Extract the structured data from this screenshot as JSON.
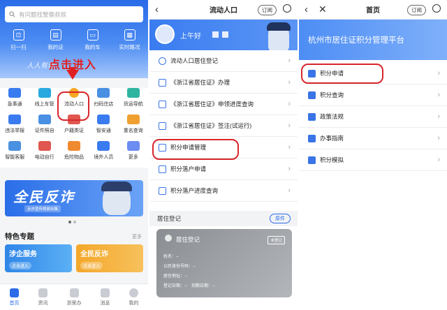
{
  "panel1": {
    "search_placeholder": "有问题找警察叔叔",
    "top_icons": [
      {
        "label": "扫一扫",
        "icon": "scan-icon"
      },
      {
        "label": "我的证",
        "icon": "card-icon"
      },
      {
        "label": "我的车",
        "icon": "car-icon"
      },
      {
        "label": "实时路况",
        "icon": "traffic-icon"
      }
    ],
    "banner_slogan": "人人有责",
    "click_hint": "点击进入",
    "grid": [
      [
        {
          "label": "急事通",
          "color": "#3a7cf0"
        },
        {
          "label": "线上车管",
          "color": "#29a8e0"
        },
        {
          "label": "流动人口",
          "color": "#f5a623"
        },
        {
          "label": "扫码住店",
          "color": "#4a90e2"
        },
        {
          "label": "货运导航",
          "color": "#2fb4a0"
        }
      ],
      [
        {
          "label": "违法举报",
          "color": "#3a7cf0"
        },
        {
          "label": "证件照自",
          "color": "#4a90e2"
        },
        {
          "label": "户籍类证",
          "color": "#e0574f"
        },
        {
          "label": "智安通",
          "color": "#3a7cf0"
        },
        {
          "label": "重名查询",
          "color": "#f0a030"
        }
      ],
      [
        {
          "label": "智能客服",
          "color": "#4a90e2"
        },
        {
          "label": "电动自行",
          "color": "#e0574f"
        },
        {
          "label": "危险物品",
          "color": "#f08a30"
        },
        {
          "label": "境外人员",
          "color": "#3a7cf0"
        },
        {
          "label": "更多",
          "color": "#6b8cf0"
        }
      ]
    ],
    "promo_title": "全民反诈",
    "promo_sub": "反诈宣传视频合集",
    "special_title": "特色专题",
    "more_label": "更多",
    "cards": [
      {
        "title": "涉企服务",
        "btn": "点击进入",
        "color": "#2f86e8"
      },
      {
        "title": "全民反诈",
        "btn": "点击进入",
        "color": "#f4a72a"
      }
    ],
    "tabs": [
      {
        "label": "首页",
        "active": true
      },
      {
        "label": "资讯",
        "active": false
      },
      {
        "label": "浙里办",
        "active": false
      },
      {
        "label": "消息",
        "active": false
      },
      {
        "label": "我的",
        "active": false
      }
    ]
  },
  "panel2": {
    "title": "流动人口",
    "subscribe": "订阅",
    "greeting": "上午好",
    "items": [
      "流动人口居住登记",
      "《浙江省居住证》办理",
      "《浙江省居住证》申领进度查询",
      "《浙江省居住证》签注(试运行)",
      "积分申请管理",
      "积分落户申请",
      "积分落户进度查询"
    ],
    "residence_label": "居住登记",
    "original_btn": "原件",
    "card_title": "居住登记",
    "card_tag": "未登记",
    "card_lines": [
      "姓名：--",
      "公民身份号码：--",
      "居住地址：--",
      "登记日期：--　到期日期：--"
    ]
  },
  "panel3": {
    "title": "首页",
    "subscribe": "订阅",
    "header_title": "杭州市居住证积分管理平台",
    "items": [
      "积分申请",
      "积分查询",
      "政策法规",
      "办事指南",
      "积分模拟"
    ]
  }
}
